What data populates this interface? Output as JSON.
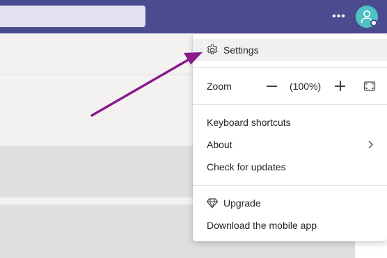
{
  "topbar": {
    "more_icon": "more-options-icon",
    "avatar_icon": "person-icon",
    "presence_icon": "presence-badge"
  },
  "menu": {
    "settings": {
      "label": "Settings",
      "icon": "gear-icon"
    },
    "zoom": {
      "label": "Zoom",
      "value": "(100%)",
      "decrease_icon": "minus-icon",
      "increase_icon": "plus-icon",
      "fullscreen_icon": "fullscreen-icon"
    },
    "keyboard_shortcuts": {
      "label": "Keyboard shortcuts"
    },
    "about": {
      "label": "About",
      "icon": "chevron-right-icon"
    },
    "check_updates": {
      "label": "Check for updates"
    },
    "upgrade": {
      "label": "Upgrade",
      "icon": "diamond-icon"
    },
    "download_mobile": {
      "label": "Download the mobile app"
    }
  },
  "colors": {
    "topbar": "#4b4b8f",
    "search_box": "#e3e2f1",
    "avatar": "#4fc1c4",
    "arrow": "#8b1a8b",
    "highlight": "#f0f0f0"
  }
}
